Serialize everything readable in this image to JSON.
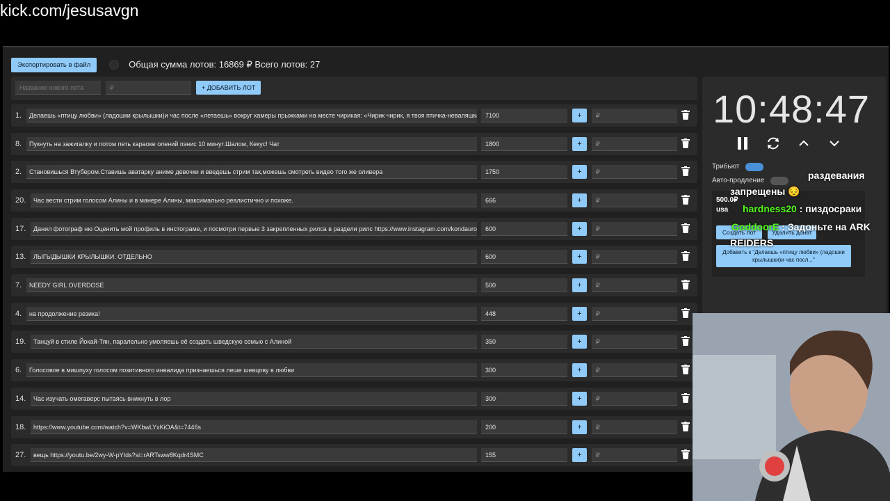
{
  "stream_url": "kick.com/jesusavgn",
  "toolbar": {
    "export_label": "Экспортировать в файл",
    "totals_text": "Общая сумма лотов: 16869 ₽ Всего лотов: 27"
  },
  "add_form": {
    "name_placeholder": "Название нового лота",
    "price_placeholder": "₽",
    "add_label": "+ ДОБАВИТЬ ЛОТ"
  },
  "currency": "₽",
  "lots": [
    {
      "num": "1.",
      "title": "Делаешь «птицу любви» (ладошки крылышки)и час после «летаешь» вокруг камеры прыжками на месте чирикая: «Чирик чирик, я твоя птичка-неваляшка",
      "amount": "7100",
      "plus": "+",
      "add_placeholder": "₽"
    },
    {
      "num": "8.",
      "title": "Пукнуть на зажигалку и потом петь караоке олений пэнис 10 минут.Шалом, Кекус! Чат",
      "amount": "1800",
      "plus": "+",
      "add_placeholder": "₽"
    },
    {
      "num": "2.",
      "title": "Становишься Втубером.Ставишь аватарку аниме девочки и введешь стрим так,можешь смотреть видео того же оливера",
      "amount": "1750",
      "plus": "+",
      "add_placeholder": "₽"
    },
    {
      "num": "20.",
      "title": "Час вести стрим голосом Алины и в манере Алины, максимально реалистично и похоже.",
      "amount": "666",
      "plus": "+",
      "add_placeholder": "₽"
    },
    {
      "num": "17.",
      "title": "Данил фотограф ню Оценить мой профиль в инстограме, и посмотри первые 3 закрепленных рилса в раздели рилс https://www.instagram.com/kondaurov",
      "amount": "600",
      "plus": "+",
      "add_placeholder": "₽"
    },
    {
      "num": "13.",
      "title": "ЛЫГЫДЫШКИ КРЫЛЫШКИ. ОТДЕЛЬНО",
      "amount": "600",
      "plus": "+",
      "add_placeholder": "₽"
    },
    {
      "num": "7.",
      "title": "NEEDY GIRL OVERDOSE",
      "amount": "500",
      "plus": "+",
      "add_placeholder": "₽"
    },
    {
      "num": "4.",
      "title": "на продолжение резика!",
      "amount": "448",
      "plus": "+",
      "add_placeholder": "₽"
    },
    {
      "num": "19.",
      "title": "Танцуй в стиле Йокай-Тян, паралельно умоляешь её создать шведскую семью с Алиной",
      "amount": "350",
      "plus": "+",
      "add_placeholder": "₽"
    },
    {
      "num": "6.",
      "title": "Голосовое в мишпуху голосом позитивного инвалида признаешься леше шевцову в любви",
      "amount": "300",
      "plus": "+",
      "add_placeholder": "₽"
    },
    {
      "num": "14.",
      "title": "Час изучать омегаверс пытаясь вникнуть в лор",
      "amount": "300",
      "plus": "+",
      "add_placeholder": "₽"
    },
    {
      "num": "18.",
      "title": "https://www.youtube.com/watch?v=WKbwLYxKiOA&t=7446s",
      "amount": "200",
      "plus": "+",
      "add_placeholder": "₽"
    },
    {
      "num": "27.",
      "title": "вещь https://youtu.be/2wy-W-pYIds?si=rARTsww8Kqdr4SMC",
      "amount": "155",
      "plus": "+",
      "add_placeholder": "₽"
    }
  ],
  "timer": {
    "time": "10:48:47",
    "tribute_label": "Трибьют",
    "autoextend_label": "Авто-продление",
    "promo_amount": "500.0₽",
    "promo_user": "usa",
    "create_lot_label": "Создать лот",
    "delete_donate_label": "Удалить донат",
    "add_to_label": "Добавить к \"Делаешь «птицу любви» (ладошки крылышки)и час посл...\""
  },
  "chat": [
    {
      "user": "",
      "text": "раздевания"
    },
    {
      "user": "",
      "text": "запрещены 😔"
    },
    {
      "user": "hardness20",
      "text": ": пиздосраки"
    },
    {
      "user": "GoddoorE",
      "text": ": Задоньте на ARK"
    },
    {
      "user": "",
      "text": "REIDERS"
    }
  ],
  "colors": {
    "accent": "#90caf9",
    "panel": "#2b2b2b",
    "chat_user_green": "#53fc18"
  }
}
